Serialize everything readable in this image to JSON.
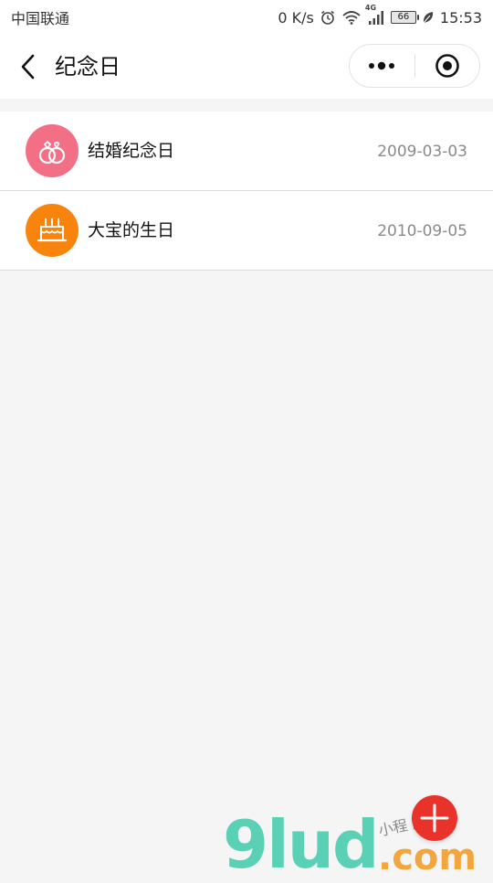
{
  "status_bar": {
    "carrier": "中国联通",
    "speed": "0 K/s",
    "network": "4G",
    "battery": "66",
    "time": "15:53"
  },
  "nav": {
    "title": "纪念日"
  },
  "list": {
    "items": [
      {
        "title": "结婚纪念日",
        "date": "2009-03-03",
        "icon": "wedding-rings-icon",
        "color": "#f36f86"
      },
      {
        "title": "大宝的生日",
        "date": "2010-09-05",
        "icon": "birthday-cake-icon",
        "color": "#f8840e"
      }
    ]
  },
  "fab": {
    "icon": "plus-icon",
    "color": "#e8322a"
  },
  "watermark": {
    "main": "9lud",
    "suffix": ".com",
    "handwriting": "小程 店"
  }
}
